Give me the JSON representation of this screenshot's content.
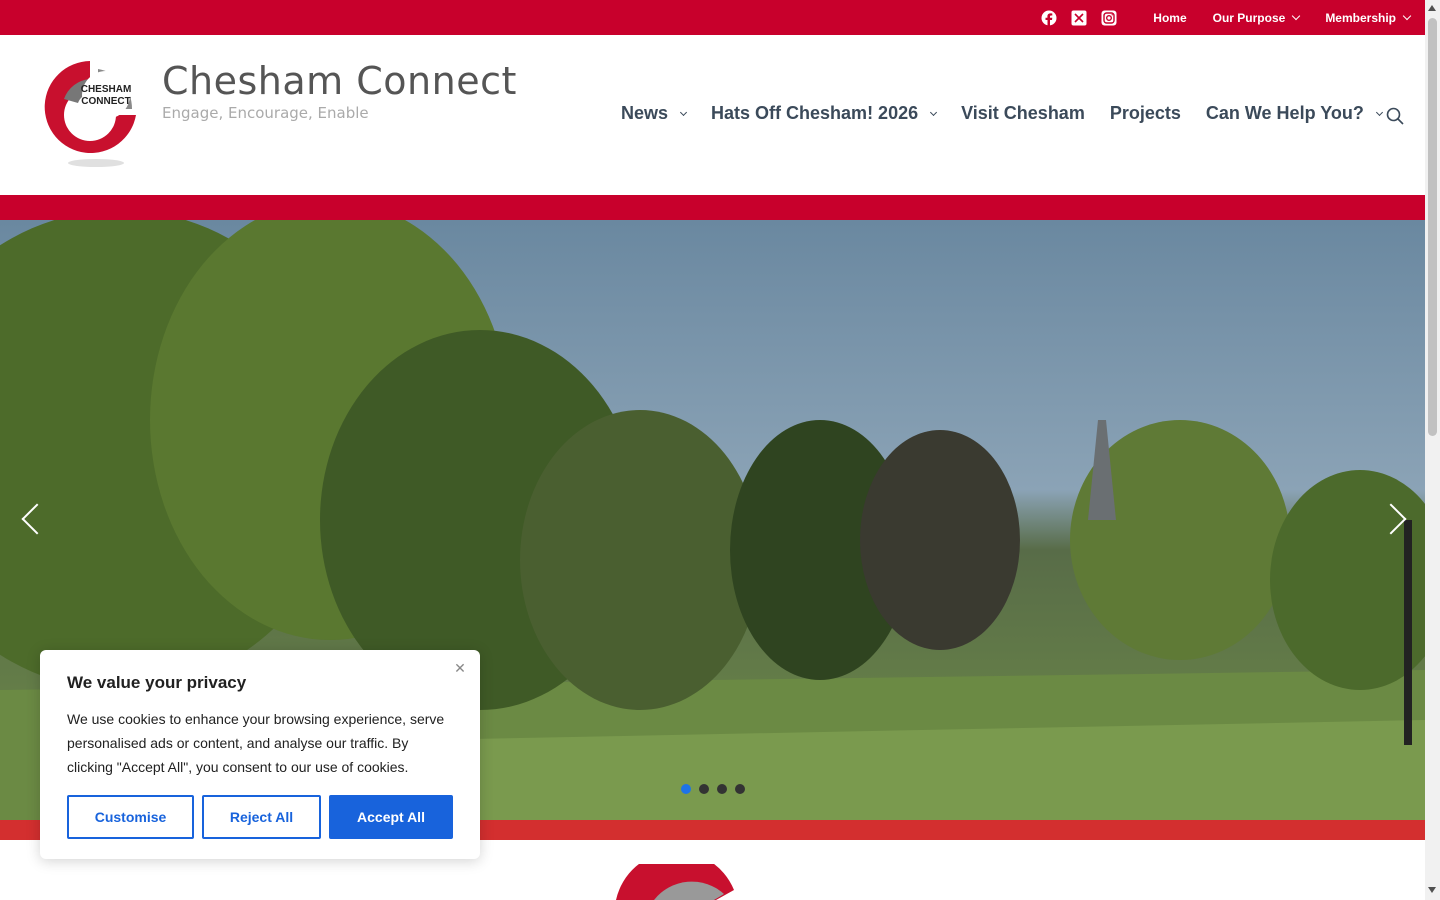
{
  "topbar": {
    "social": [
      {
        "icon": "facebook-icon"
      },
      {
        "icon": "x-twitter-icon"
      },
      {
        "icon": "instagram-icon"
      }
    ],
    "nav": [
      {
        "label": "Home",
        "has_dropdown": false
      },
      {
        "label": "Our Purpose",
        "has_dropdown": true
      },
      {
        "label": "Membership",
        "has_dropdown": true
      }
    ]
  },
  "header": {
    "logo_text_1": "CHESHAM",
    "logo_text_2": "CONNECT",
    "title": "Chesham Connect",
    "tagline": "Engage, Encourage, Enable",
    "nav": [
      {
        "label": "News",
        "has_dropdown": true
      },
      {
        "label": "Hats Off Chesham! 2026",
        "has_dropdown": true
      },
      {
        "label": "Visit Chesham",
        "has_dropdown": false
      },
      {
        "label": "Projects",
        "has_dropdown": false
      },
      {
        "label": "Can We Help You?",
        "has_dropdown": true
      }
    ],
    "search_icon": "search-icon"
  },
  "slider": {
    "slides": 4,
    "active_slide": 1,
    "prev_icon": "chevron-left-icon",
    "next_icon": "chevron-right-icon"
  },
  "cookie_banner": {
    "title": "We value your privacy",
    "body": "We use cookies to enhance your browsing experience, serve personalised ads or content, and analyse our traffic. By clicking \"Accept All\", you consent to our use of cookies.",
    "customise_label": "Customise",
    "reject_label": "Reject All",
    "accept_label": "Accept All"
  },
  "colors": {
    "brand_red": "#c8002c",
    "nav_text": "#3b4a5a",
    "cookie_blue": "#1863dc",
    "dot_active": "#1e73e8"
  }
}
